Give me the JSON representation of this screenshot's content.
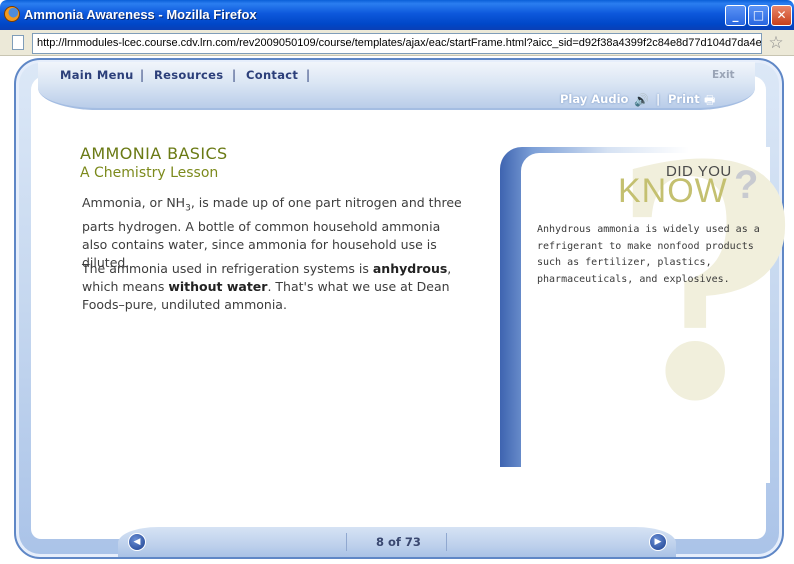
{
  "window": {
    "title": "Ammonia Awareness - Mozilla Firefox",
    "minimize_glyph": "_",
    "maximize_glyph": "□",
    "close_glyph": "✕"
  },
  "addressbar": {
    "url": "http://lrnmodules-lcec.course.cdv.lrn.com/rev2009050109/course/templates/ajax/eac/startFrame.html?aicc_sid=d92f38a4399f2c84e8d77d104d7da4e"
  },
  "nav": {
    "items": [
      {
        "label": "Main Menu"
      },
      {
        "label": "Resources"
      },
      {
        "label": "Contact"
      }
    ],
    "separator": "|",
    "exit_label": "Exit",
    "play_audio_label": "Play Audio",
    "print_label": "Print"
  },
  "lesson": {
    "title": "AMMONIA BASICS",
    "subtitle": "A Chemistry Lesson",
    "p1_a": "Ammonia, or NH",
    "p1_sub": "3",
    "p1_b": ", is made up of one part nitrogen and three parts hydrogen. A bottle of common household ammonia also contains water, since ammonia for household use is diluted.",
    "p2_a": "The ammonia used in refrigeration systems is ",
    "p2_bold1": "anhydrous",
    "p2_b": ", which means ",
    "p2_bold2": "without water",
    "p2_c": ". That's what we use at Dean Foods–pure, undiluted ammonia."
  },
  "did_you_know": {
    "heading_top": "DID YOU",
    "heading_bottom": "KNOW",
    "qmark": "?",
    "text": "Anhydrous ammonia is widely used as a refrigerant to make nonfood products such as fertilizer, plastics, pharmaceuticals, and explosives."
  },
  "footer": {
    "page_indicator": "8 of 73",
    "prev_glyph": "◀",
    "next_glyph": "▶"
  },
  "icons": {
    "speaker": "🔊",
    "printer": "🖶"
  }
}
